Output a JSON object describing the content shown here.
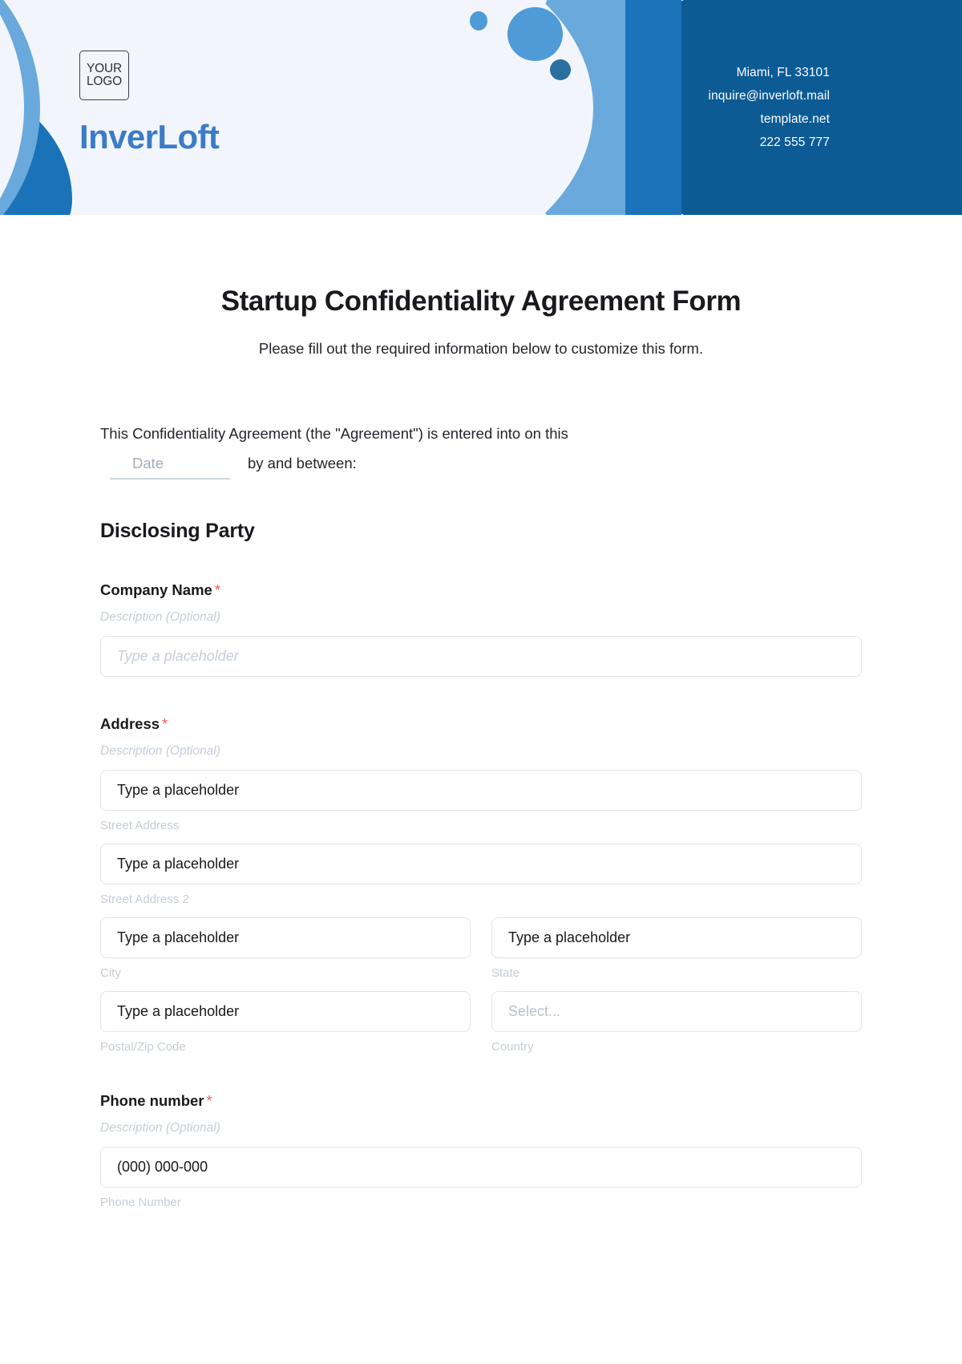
{
  "header": {
    "logo_line1": "YOUR",
    "logo_line2": "LOGO",
    "brand": "InverLoft",
    "contact": {
      "address": "Miami, FL 33101",
      "email": "inquire@inverloft.mail",
      "website": "template.net",
      "phone": "222 555 777"
    },
    "colors": {
      "pale_bg": "#f2f6fc",
      "dark_blue": "#0c5b95",
      "mid_blue": "#1a73b8",
      "light_blue": "#6aa9dc",
      "dot_blue": "#4e9bd8",
      "dot_dark": "#2a6f9e",
      "brand_blue": "#3b7bc8"
    }
  },
  "form": {
    "title": "Startup Confidentiality Agreement Form",
    "subtitle": "Please fill out the required information below to customize this form.",
    "intro_text": "This Confidentiality Agreement (the \"Agreement\") is entered into on this",
    "date_placeholder": "Date",
    "intro_tail": "by and between:",
    "section_title": "Disclosing Party",
    "required_marker": "*",
    "description_optional": "Description (Optional)",
    "placeholder_text": "Type a placeholder",
    "select_placeholder": "Select...",
    "fields": {
      "company_name": {
        "label": "Company Name",
        "description": "Description (Optional)",
        "placeholder": "Type a placeholder"
      },
      "address": {
        "label": "Address",
        "description": "Description (Optional)",
        "lines": [
          {
            "placeholder": "Type a placeholder",
            "sub_label": "Street Address"
          },
          {
            "placeholder": "Type a placeholder",
            "sub_label": "Street Address 2"
          }
        ],
        "city": {
          "placeholder": "Type a placeholder",
          "sub_label": "City"
        },
        "state": {
          "placeholder": "Type a placeholder",
          "sub_label": "State"
        },
        "postal": {
          "placeholder": "Type a placeholder",
          "sub_label": "Postal/Zip Code"
        },
        "country": {
          "placeholder": "Select...",
          "sub_label": "Country"
        }
      },
      "phone_number": {
        "label": "Phone number",
        "description": "Description (Optional)",
        "placeholder": "(000) 000-000",
        "sub_label": "Phone Number"
      }
    }
  }
}
